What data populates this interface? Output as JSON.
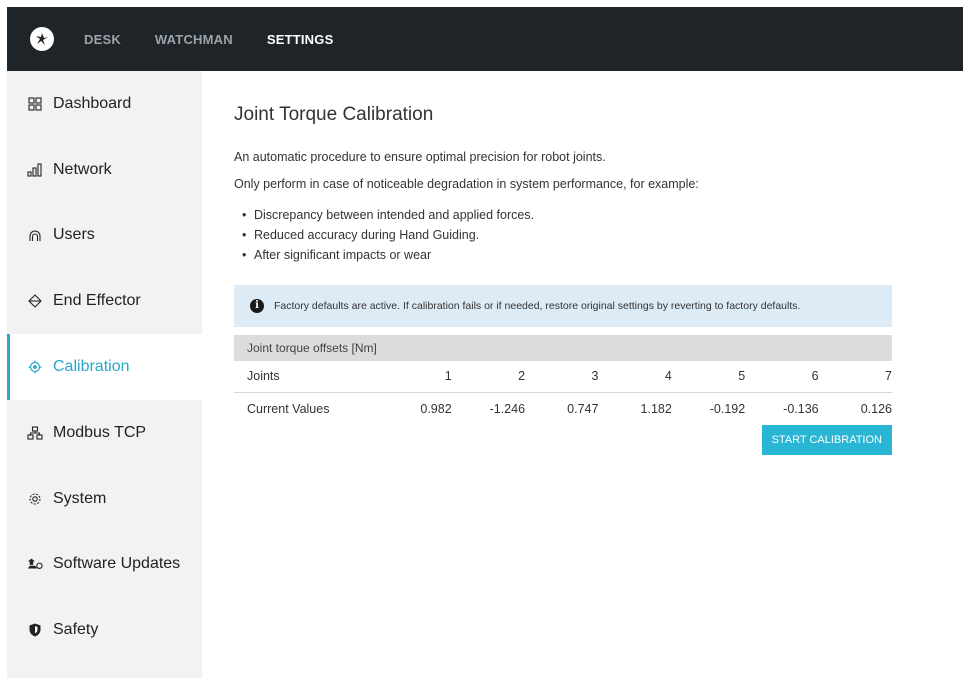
{
  "topbar": {
    "logo": "robot-logo-icon",
    "nav": [
      "DESK",
      "WATCHMAN",
      "SETTINGS"
    ],
    "active": "SETTINGS"
  },
  "sidebar": {
    "items": [
      {
        "label": "Dashboard",
        "icon": "grid-icon"
      },
      {
        "label": "Network",
        "icon": "signal-bars-icon"
      },
      {
        "label": "Users",
        "icon": "user-icon"
      },
      {
        "label": "End Effector",
        "icon": "gripper-icon"
      },
      {
        "label": "Calibration",
        "icon": "crosshair-icon",
        "active": true
      },
      {
        "label": "Modbus TCP",
        "icon": "network-tree-icon"
      },
      {
        "label": "System",
        "icon": "gear-icon"
      },
      {
        "label": "Software Updates",
        "icon": "update-icon"
      },
      {
        "label": "Safety",
        "icon": "shield-icon"
      }
    ]
  },
  "main": {
    "title": "Joint Torque Calibration",
    "description": "An automatic procedure to ensure optimal precision for robot joints.",
    "description2": "Only perform in case of noticeable degradation in system performance, for example:",
    "bullets": [
      "Discrepancy between intended and applied forces.",
      "Reduced accuracy during Hand Guiding.",
      "After significant impacts or wear"
    ],
    "info": "Factory defaults are active. If calibration fails or if needed, restore original settings by reverting to factory defaults.",
    "table": {
      "caption": "Joint torque offsets [Nm]",
      "header_label": "Joints",
      "joints": [
        "1",
        "2",
        "3",
        "4",
        "5",
        "6",
        "7"
      ],
      "values_label": "Current Values",
      "values": [
        "0.982",
        "-1.246",
        "0.747",
        "1.182",
        "-0.192",
        "-0.136",
        "0.126"
      ]
    },
    "button": "START CALIBRATION"
  },
  "colors": {
    "accent": "#29b6d4",
    "topbar": "#1f2428",
    "info_bg": "#ddebf7"
  }
}
